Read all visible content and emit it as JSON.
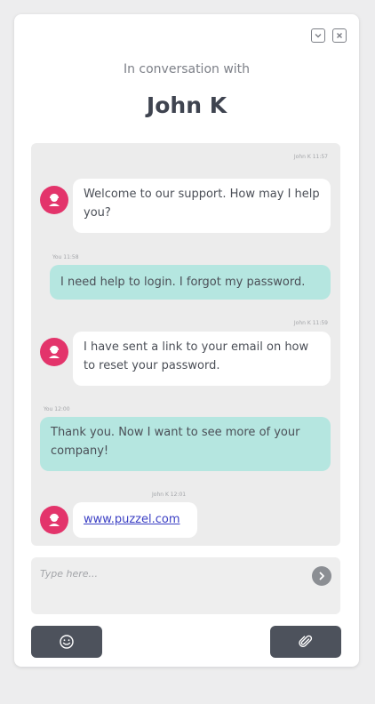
{
  "header": {
    "subtitle": "In conversation with",
    "name": "John K"
  },
  "window_controls": [
    {
      "icon": "minimize-chevron-icon"
    },
    {
      "icon": "close-icon"
    }
  ],
  "messages": [
    {
      "sender": "agent",
      "meta": "John K 11:57",
      "text": "Welcome to our support. How may I help you?"
    },
    {
      "sender": "user",
      "meta": "You 11:58",
      "text": "I need help to login. I forgot my password."
    },
    {
      "sender": "agent",
      "meta": "John K 11:59",
      "text": "I have sent a link to your email on how to reset your password."
    },
    {
      "sender": "user",
      "meta": "You 12:00",
      "text": "Thank you. Now I want to see more of your company!"
    },
    {
      "sender": "agent",
      "meta": "John K 12:01",
      "text": "www.puzzel.com",
      "is_link": true
    }
  ],
  "composer": {
    "placeholder": "Type here..."
  },
  "colors": {
    "avatar": "#e3346b",
    "user_bubble": "#b5e6e0",
    "agent_bubble": "#ffffff",
    "tool_button": "#4d525c",
    "link": "#3b3fc4"
  },
  "icons": {
    "emoji_button": "smiley-icon",
    "attach_button": "paperclip-icon",
    "send_button": "send-arrow-icon",
    "avatar": "agent-avatar-icon"
  }
}
